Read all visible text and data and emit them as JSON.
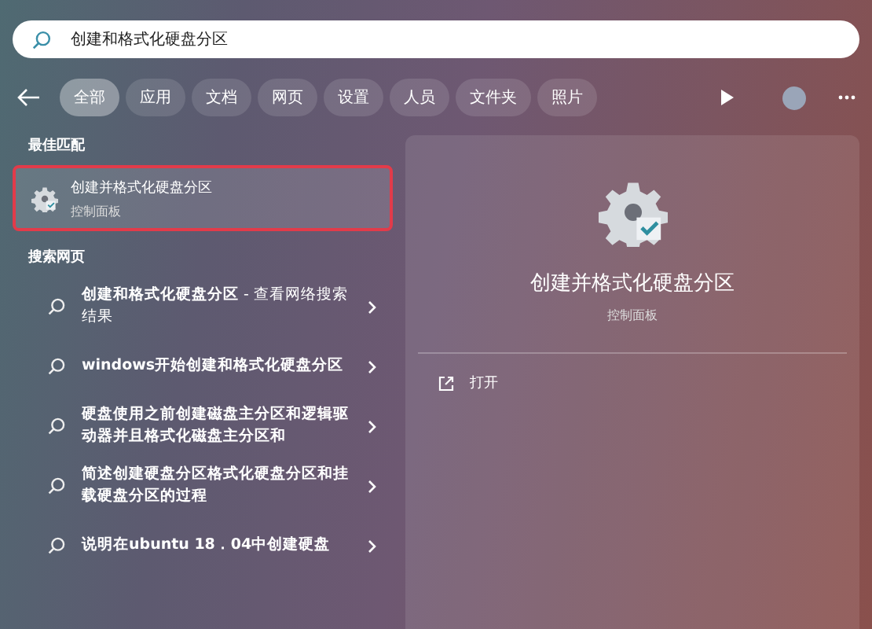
{
  "search": {
    "value": "创建和格式化硬盘分区"
  },
  "filters": [
    {
      "label": "全部",
      "selected": true
    },
    {
      "label": "应用",
      "selected": false
    },
    {
      "label": "文档",
      "selected": false
    },
    {
      "label": "网页",
      "selected": false
    },
    {
      "label": "设置",
      "selected": false
    },
    {
      "label": "人员",
      "selected": false
    },
    {
      "label": "文件夹",
      "selected": false
    },
    {
      "label": "照片",
      "selected": false
    }
  ],
  "best_match": {
    "heading": "最佳匹配",
    "title": "创建并格式化硬盘分区",
    "subtitle": "控制面板",
    "selected": true
  },
  "web": {
    "heading": "搜索网页",
    "results": [
      {
        "title": "创建和格式化硬盘分区",
        "suffix": " - 查看网络搜索结果"
      },
      {
        "title": "windows开始创建和格式化硬盘分区"
      },
      {
        "title": "硬盘使用之前创建磁盘主分区和逻辑驱动器并且格式化磁盘主分区和"
      },
      {
        "title": "简述创建硬盘分区格式化硬盘分区和挂载硬盘分区的过程"
      },
      {
        "title": "说明在ubuntu 18．04中创建硬盘"
      }
    ]
  },
  "preview": {
    "title": "创建并格式化硬盘分区",
    "subtitle": "控制面板",
    "actions": [
      {
        "label": "打开"
      }
    ]
  }
}
